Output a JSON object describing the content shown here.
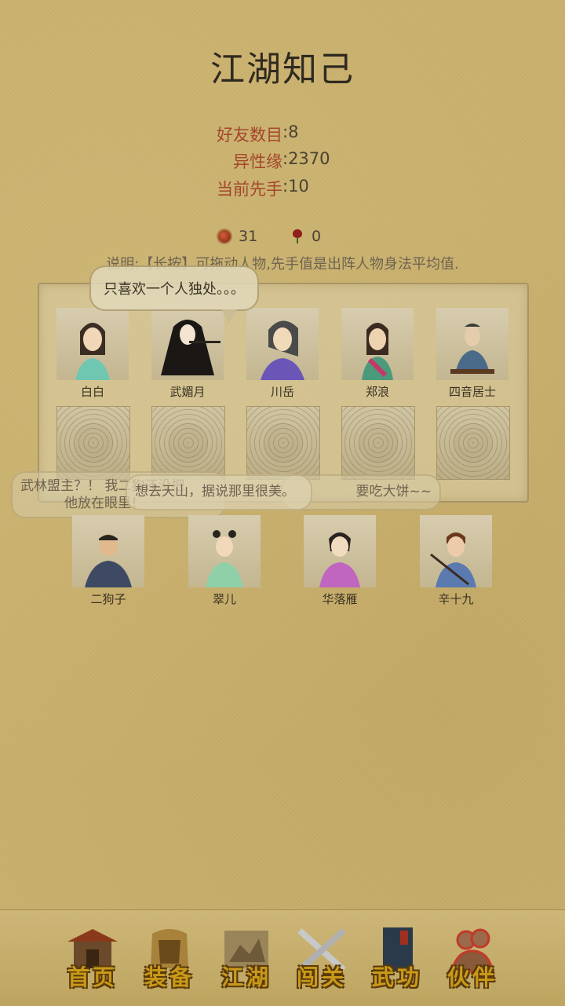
{
  "title": "江湖知己",
  "stats": [
    {
      "label": "好友数目",
      "value": ":8"
    },
    {
      "label": "异性缘",
      "value": ":2370"
    },
    {
      "label": "当前先手",
      "value": ":10"
    }
  ],
  "counters": {
    "tilted": "31",
    "rose": "0"
  },
  "note": "说明:【长按】可拖动人物,先手值是出阵人物身法平均值.",
  "party": [
    {
      "name": "白白"
    },
    {
      "name": "武媚月"
    },
    {
      "name": "川岳"
    },
    {
      "name": "郑浪"
    },
    {
      "name": "四音居士"
    }
  ],
  "bench": [
    {
      "name": "二狗子"
    },
    {
      "name": "翠儿"
    },
    {
      "name": "华落雁"
    },
    {
      "name": "辛十九"
    }
  ],
  "bubbles": {
    "main": "只喜欢一个人独处。。。",
    "left_line1": "武林盟主？！ 我二狗还没把",
    "left_line2": "他放在眼里！",
    "middle": "想去天山，据说那里很美。",
    "right": "要吃大饼~~"
  },
  "nav": [
    {
      "label": "首页",
      "icon": "temple-icon"
    },
    {
      "label": "装备",
      "icon": "armor-icon"
    },
    {
      "label": "江湖",
      "icon": "scroll-map-icon"
    },
    {
      "label": "闯关",
      "icon": "crossed-swords-icon"
    },
    {
      "label": "武功",
      "icon": "book-icon"
    },
    {
      "label": "伙伴",
      "icon": "partners-icon"
    }
  ]
}
